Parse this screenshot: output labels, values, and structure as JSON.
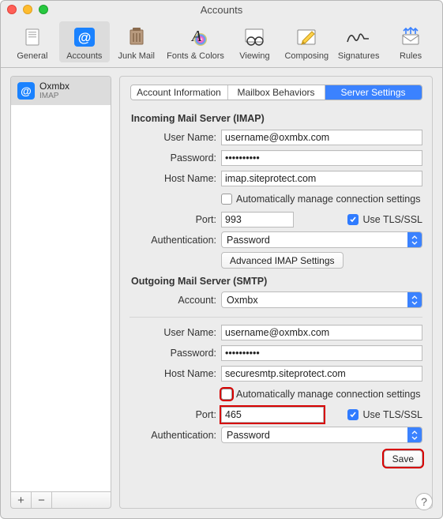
{
  "window": {
    "title": "Accounts"
  },
  "toolbar": {
    "items": [
      {
        "label": "General"
      },
      {
        "label": "Accounts"
      },
      {
        "label": "Junk Mail"
      },
      {
        "label": "Fonts & Colors"
      },
      {
        "label": "Viewing"
      },
      {
        "label": "Composing"
      },
      {
        "label": "Signatures"
      },
      {
        "label": "Rules"
      }
    ]
  },
  "sidebar": {
    "account": {
      "name": "Oxmbx",
      "subtype": "IMAP"
    }
  },
  "tabs": {
    "items": [
      {
        "label": "Account Information"
      },
      {
        "label": "Mailbox Behaviors"
      },
      {
        "label": "Server Settings"
      }
    ]
  },
  "incoming": {
    "heading": "Incoming Mail Server (IMAP)",
    "labels": {
      "username": "User Name:",
      "password": "Password:",
      "hostname": "Host Name:",
      "port": "Port:",
      "auth": "Authentication:"
    },
    "username": "username@oxmbx.com",
    "password": "••••••••••",
    "hostname": "imap.siteprotect.com",
    "auto_label": "Automatically manage connection settings",
    "port": "993",
    "tls_label": "Use TLS/SSL",
    "auth": "Password",
    "advanced_btn": "Advanced IMAP Settings"
  },
  "outgoing": {
    "heading": "Outgoing Mail Server (SMTP)",
    "labels": {
      "account": "Account:",
      "username": "User Name:",
      "password": "Password:",
      "hostname": "Host Name:",
      "port": "Port:",
      "auth": "Authentication:"
    },
    "account": "Oxmbx",
    "username": "username@oxmbx.com",
    "password": "••••••••••",
    "hostname": "securesmtp.siteprotect.com",
    "auto_label": "Automatically manage connection settings",
    "port": "465",
    "tls_label": "Use TLS/SSL",
    "auth": "Password"
  },
  "save_label": "Save",
  "footer": {
    "plus": "+",
    "minus": "−"
  },
  "help": "?"
}
